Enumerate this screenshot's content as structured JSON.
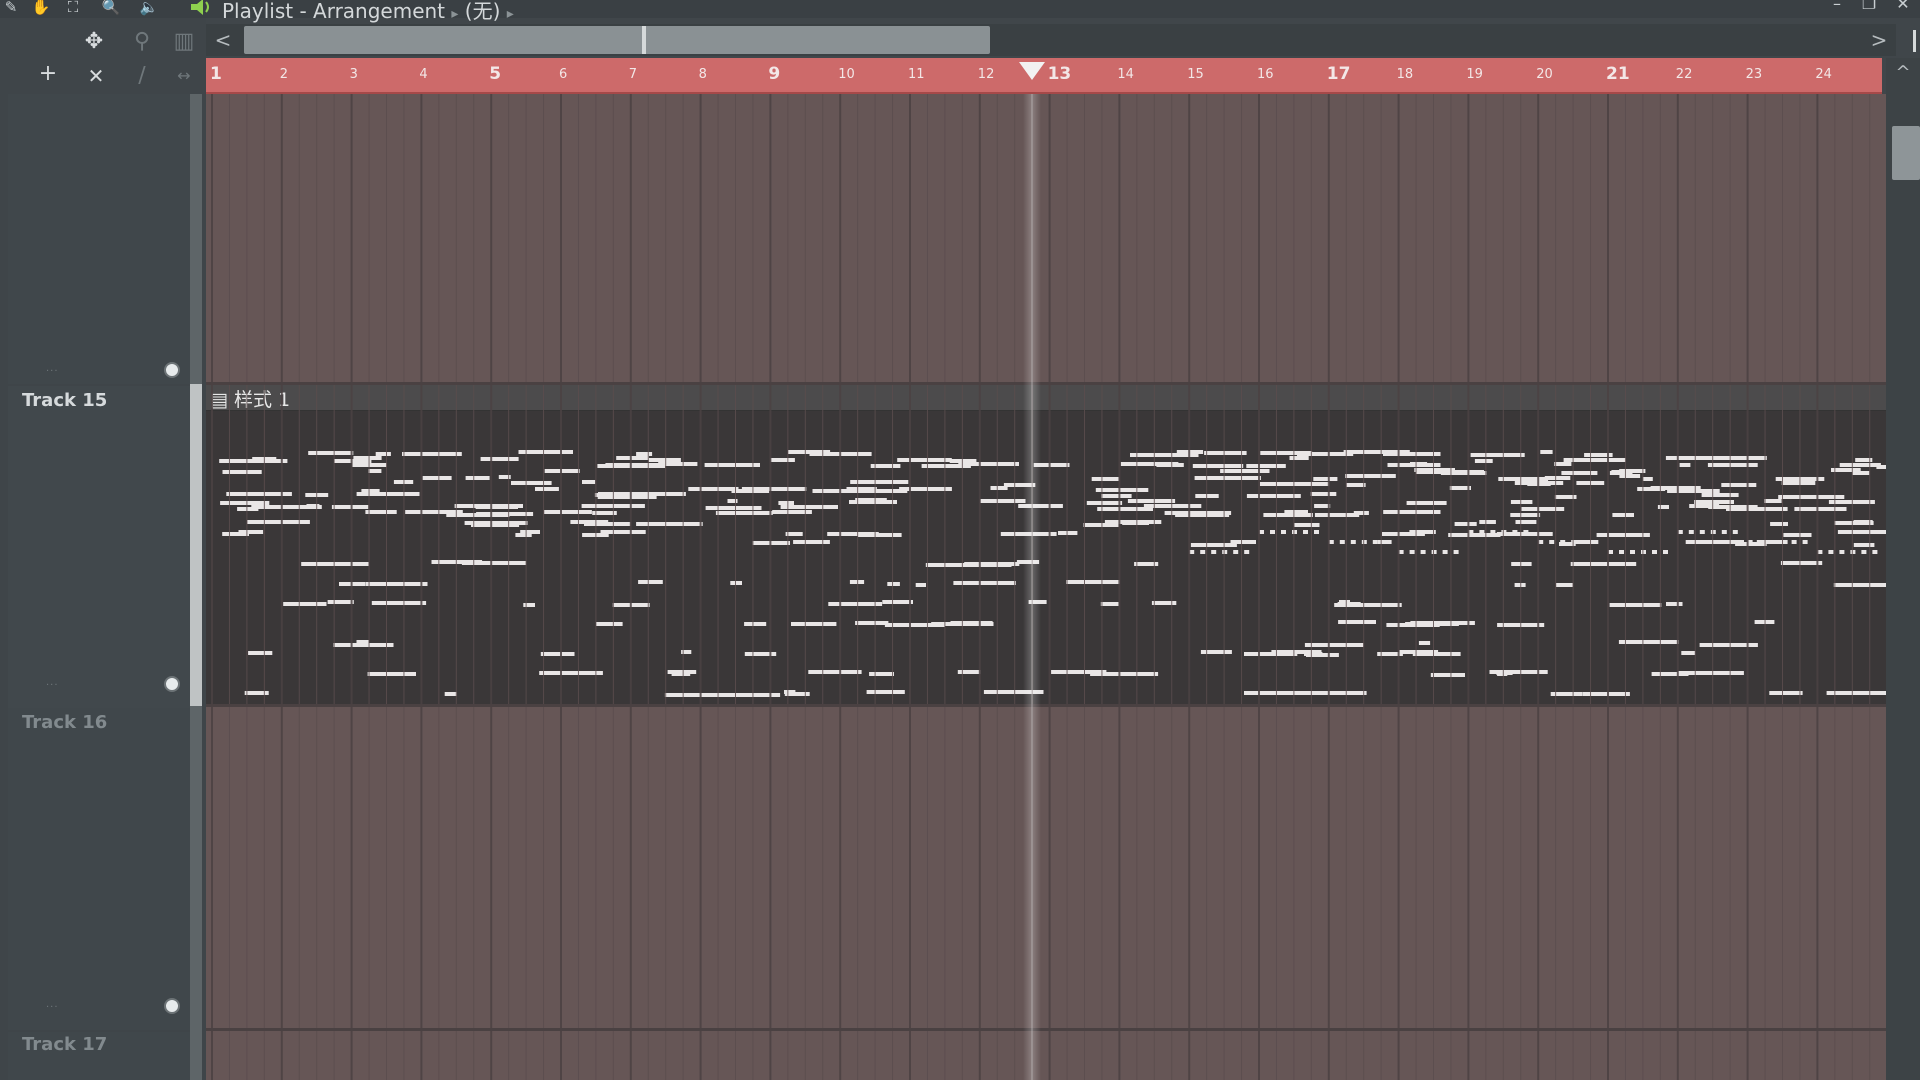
{
  "window": {
    "title": "Playlist - Arrangement",
    "breadcrumb_sep": "▸",
    "breadcrumb_item": "(无)",
    "breadcrumb_end": "▸",
    "controls": {
      "minimize": "–",
      "restore": "❐",
      "close": "✕"
    }
  },
  "toolbar": {
    "tools": [
      {
        "name": "draw-tool-icon",
        "glyph": "✎"
      },
      {
        "name": "paint-tool-icon",
        "glyph": "✋"
      },
      {
        "name": "select-tool-icon",
        "glyph": "⛶"
      },
      {
        "name": "zoom-tool-icon",
        "glyph": "🔍"
      },
      {
        "name": "playback-tool-icon",
        "glyph": "🔈"
      }
    ],
    "row1": {
      "snap_glyph": "✥",
      "link_glyph": "⚲",
      "bars_glyph": "▥"
    },
    "row2": {
      "add_glyph": "+",
      "delete_glyph": "✕",
      "slide_glyph": "∕",
      "stretch_glyph": "↔"
    }
  },
  "ruler": {
    "bars": [
      "1",
      "2",
      "3",
      "4",
      "5",
      "6",
      "7",
      "8",
      "9",
      "10",
      "11",
      "12",
      "13",
      "14",
      "15",
      "16",
      "17",
      "18",
      "19",
      "20",
      "21",
      "22",
      "23",
      "24",
      "2"
    ],
    "major": [
      "1",
      "5",
      "9",
      "13",
      "17",
      "21"
    ]
  },
  "scroll": {
    "left_glyph": "<",
    "right_glyph": ">",
    "up_glyph": "^"
  },
  "tracks": [
    {
      "name": "",
      "active": false
    },
    {
      "name": "Track 15",
      "active": true
    },
    {
      "name": "Track 16",
      "active": false
    },
    {
      "name": "Track 17",
      "active": false
    }
  ],
  "clip": {
    "name": "▤ 样式 1",
    "pattern": "样式 1"
  },
  "playhead": {
    "bar": 12.75
  },
  "colors": {
    "ruler": "#cd6a6a",
    "lane": "#665656",
    "clip_bg": "#3a3738",
    "note": "#e9e6e6"
  }
}
